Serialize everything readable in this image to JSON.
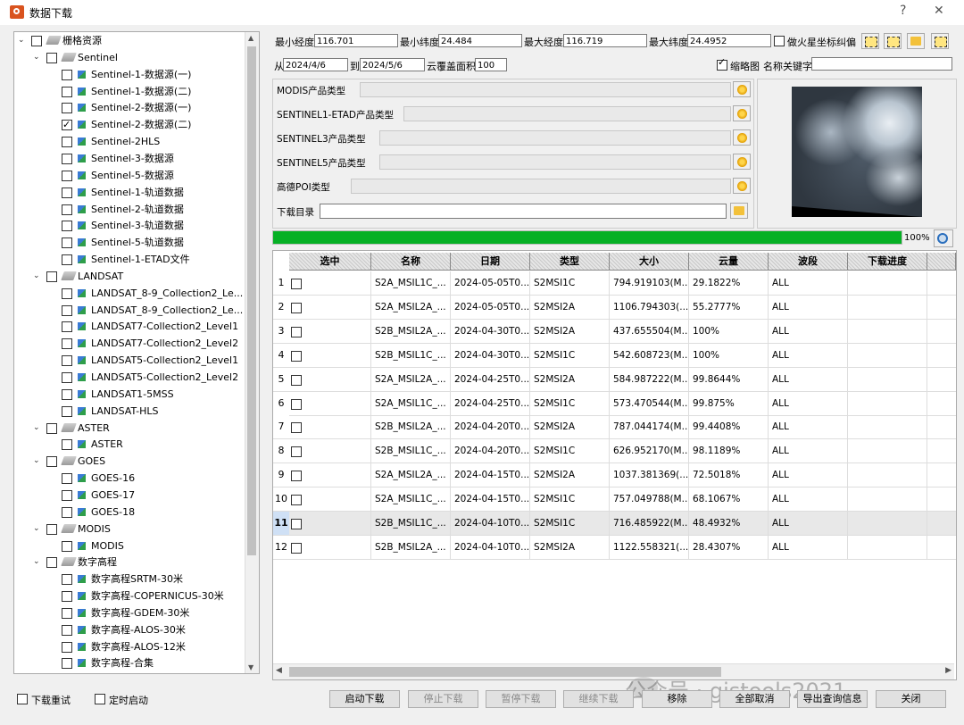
{
  "window": {
    "title": "数据下载",
    "help": "?",
    "close": "✕"
  },
  "tree": [
    {
      "level": 0,
      "arrow": "⌄",
      "label": "栅格资源",
      "icon": "stack",
      "checked": false
    },
    {
      "level": 1,
      "arrow": "⌄",
      "label": "Sentinel",
      "icon": "stack",
      "checked": false
    },
    {
      "level": 2,
      "label": "Sentinel-1-数据源(一)",
      "checked": false
    },
    {
      "level": 2,
      "label": "Sentinel-1-数据源(二)",
      "checked": false
    },
    {
      "level": 2,
      "label": "Sentinel-2-数据源(一)",
      "checked": false
    },
    {
      "level": 2,
      "label": "Sentinel-2-数据源(二)",
      "checked": true
    },
    {
      "level": 2,
      "label": "Sentinel-2HLS",
      "checked": false
    },
    {
      "level": 2,
      "label": "Sentinel-3-数据源",
      "checked": false
    },
    {
      "level": 2,
      "label": "Sentinel-5-数据源",
      "checked": false
    },
    {
      "level": 2,
      "label": "Sentinel-1-轨道数据",
      "checked": false
    },
    {
      "level": 2,
      "label": "Sentinel-2-轨道数据",
      "checked": false
    },
    {
      "level": 2,
      "label": "Sentinel-3-轨道数据",
      "checked": false
    },
    {
      "level": 2,
      "label": "Sentinel-5-轨道数据",
      "checked": false
    },
    {
      "level": 2,
      "label": "Sentinel-1-ETAD文件",
      "checked": false
    },
    {
      "level": 1,
      "arrow": "⌄",
      "label": "LANDSAT",
      "icon": "stack",
      "checked": false
    },
    {
      "level": 2,
      "label": "LANDSAT_8-9_Collection2_Le...",
      "checked": false
    },
    {
      "level": 2,
      "label": "LANDSAT_8-9_Collection2_Le...",
      "checked": false
    },
    {
      "level": 2,
      "label": "LANDSAT7-Collection2_Level1",
      "checked": false
    },
    {
      "level": 2,
      "label": "LANDSAT7-Collection2_Level2",
      "checked": false
    },
    {
      "level": 2,
      "label": "LANDSAT5-Collection2_Level1",
      "checked": false
    },
    {
      "level": 2,
      "label": "LANDSAT5-Collection2_Level2",
      "checked": false
    },
    {
      "level": 2,
      "label": "LANDSAT1-5MSS",
      "checked": false
    },
    {
      "level": 2,
      "label": "LANDSAT-HLS",
      "checked": false
    },
    {
      "level": 1,
      "arrow": "⌄",
      "label": "ASTER",
      "icon": "stack",
      "checked": false
    },
    {
      "level": 2,
      "label": "ASTER",
      "checked": false
    },
    {
      "level": 1,
      "arrow": "⌄",
      "label": "GOES",
      "icon": "stack",
      "checked": false
    },
    {
      "level": 2,
      "label": "GOES-16",
      "checked": false
    },
    {
      "level": 2,
      "label": "GOES-17",
      "checked": false
    },
    {
      "level": 2,
      "label": "GOES-18",
      "checked": false
    },
    {
      "level": 1,
      "arrow": "⌄",
      "label": "MODIS",
      "icon": "stack",
      "checked": false
    },
    {
      "level": 2,
      "label": "MODIS",
      "checked": false
    },
    {
      "level": 1,
      "arrow": "⌄",
      "label": "数字高程",
      "icon": "stack",
      "checked": false
    },
    {
      "level": 2,
      "label": "数字高程SRTM-30米",
      "checked": false
    },
    {
      "level": 2,
      "label": "数字高程-COPERNICUS-30米",
      "checked": false
    },
    {
      "level": 2,
      "label": "数字高程-GDEM-30米",
      "checked": false
    },
    {
      "level": 2,
      "label": "数字高程-ALOS-30米",
      "checked": false
    },
    {
      "level": 2,
      "label": "数字高程-ALOS-12米",
      "checked": false
    },
    {
      "level": 2,
      "label": "数字高程-合集",
      "checked": false
    }
  ],
  "filters": {
    "min_lon_label": "最小经度",
    "min_lon": "116.701",
    "min_lat_label": "最小纬度",
    "min_lat": "24.484",
    "max_lon_label": "最大经度",
    "max_lon": "116.719",
    "max_lat_label": "最大纬度",
    "max_lat": "24.4952",
    "mars_label": "做火星坐标纠偏",
    "from_label": "从",
    "from_date": "2024/4/6",
    "to_label": "到",
    "to_date": "2024/5/6",
    "cloud_label": "云覆盖面积",
    "cloud": "100",
    "thumb_label": "缩略图",
    "keyword_label": "名称关键字",
    "keyword": ""
  },
  "products": [
    {
      "label": "MODIS产品类型"
    },
    {
      "label": "SENTINEL1-ETAD产品类型"
    },
    {
      "label": "SENTINEL3产品类型"
    },
    {
      "label": "SENTINEL5产品类型"
    },
    {
      "label": "高德POI类型"
    }
  ],
  "download_dir_label": "下载目录",
  "download_dir": "",
  "progress": {
    "value": 1.0,
    "label": "100%"
  },
  "table": {
    "headers": [
      "选中",
      "名称",
      "日期",
      "类型",
      "大小",
      "云量",
      "波段",
      "下载进度",
      ""
    ],
    "rows": [
      {
        "n": "1",
        "name": "S2A_MSIL1C_...",
        "date": "2024-05-05T0...",
        "type": "S2MSI1C",
        "size": "794.919103(M...",
        "cloud": "29.1822%",
        "band": "ALL"
      },
      {
        "n": "2",
        "name": "S2A_MSIL2A_...",
        "date": "2024-05-05T0...",
        "type": "S2MSI2A",
        "size": "1106.794303(...",
        "cloud": "55.2777%",
        "band": "ALL"
      },
      {
        "n": "3",
        "name": "S2B_MSIL2A_...",
        "date": "2024-04-30T0...",
        "type": "S2MSI2A",
        "size": "437.655504(M...",
        "cloud": "100%",
        "band": "ALL"
      },
      {
        "n": "4",
        "name": "S2B_MSIL1C_...",
        "date": "2024-04-30T0...",
        "type": "S2MSI1C",
        "size": "542.608723(M...",
        "cloud": "100%",
        "band": "ALL"
      },
      {
        "n": "5",
        "name": "S2A_MSIL2A_...",
        "date": "2024-04-25T0...",
        "type": "S2MSI2A",
        "size": "584.987222(M...",
        "cloud": "99.8644%",
        "band": "ALL"
      },
      {
        "n": "6",
        "name": "S2A_MSIL1C_...",
        "date": "2024-04-25T0...",
        "type": "S2MSI1C",
        "size": "573.470544(M...",
        "cloud": "99.875%",
        "band": "ALL"
      },
      {
        "n": "7",
        "name": "S2B_MSIL2A_...",
        "date": "2024-04-20T0...",
        "type": "S2MSI2A",
        "size": "787.044174(M...",
        "cloud": "99.4408%",
        "band": "ALL"
      },
      {
        "n": "8",
        "name": "S2B_MSIL1C_...",
        "date": "2024-04-20T0...",
        "type": "S2MSI1C",
        "size": "626.952170(M...",
        "cloud": "98.1189%",
        "band": "ALL"
      },
      {
        "n": "9",
        "name": "S2A_MSIL2A_...",
        "date": "2024-04-15T0...",
        "type": "S2MSI2A",
        "size": "1037.381369(...",
        "cloud": "72.5018%",
        "band": "ALL"
      },
      {
        "n": "10",
        "name": "S2A_MSIL1C_...",
        "date": "2024-04-15T0...",
        "type": "S2MSI1C",
        "size": "757.049788(M...",
        "cloud": "68.1067%",
        "band": "ALL"
      },
      {
        "n": "11",
        "name": "S2B_MSIL1C_...",
        "date": "2024-04-10T0...",
        "type": "S2MSI1C",
        "size": "716.485922(M...",
        "cloud": "48.4932%",
        "band": "ALL"
      },
      {
        "n": "12",
        "name": "S2B_MSIL2A_...",
        "date": "2024-04-10T0...",
        "type": "S2MSI2A",
        "size": "1122.558321(...",
        "cloud": "28.4307%",
        "band": "ALL"
      }
    ]
  },
  "bottom": {
    "retry": "下载重试",
    "timer": "定时启动",
    "start": "启动下载",
    "stop": "停止下载",
    "pause": "暂停下载",
    "resume": "继续下载",
    "remove": "移除",
    "cancel_all": "全部取消",
    "export": "导出查询信息",
    "close": "关闭"
  },
  "watermark": "公众号 · gistools2021"
}
